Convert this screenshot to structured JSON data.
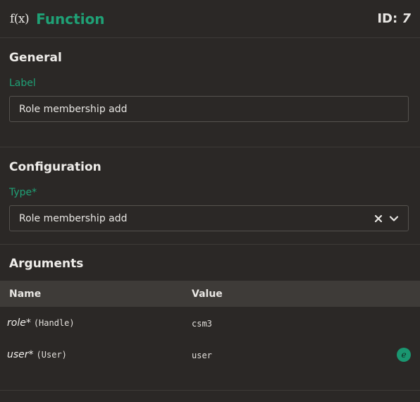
{
  "header": {
    "icon": "function-fx-icon",
    "fx_symbol": "f(x)",
    "title": "Function",
    "id_prefix": "ID: ",
    "id_value": "7"
  },
  "general": {
    "title": "General",
    "label_field": {
      "label": "Label",
      "value": "Role membership add"
    }
  },
  "configuration": {
    "title": "Configuration",
    "type_field": {
      "label": "Type*",
      "value": "Role membership add"
    }
  },
  "arguments": {
    "title": "Arguments",
    "columns": {
      "name": "Name",
      "value": "Value"
    },
    "rows": [
      {
        "name": "role*",
        "type": "(Handle)",
        "value": "csm3"
      },
      {
        "name": "user*",
        "type": "(User)",
        "value": "user",
        "icon": "expression-icon",
        "icon_glyph": "e"
      }
    ]
  },
  "colors": {
    "accent": "#1fa176",
    "background": "#2b2826",
    "table_header": "#3e3b38"
  }
}
